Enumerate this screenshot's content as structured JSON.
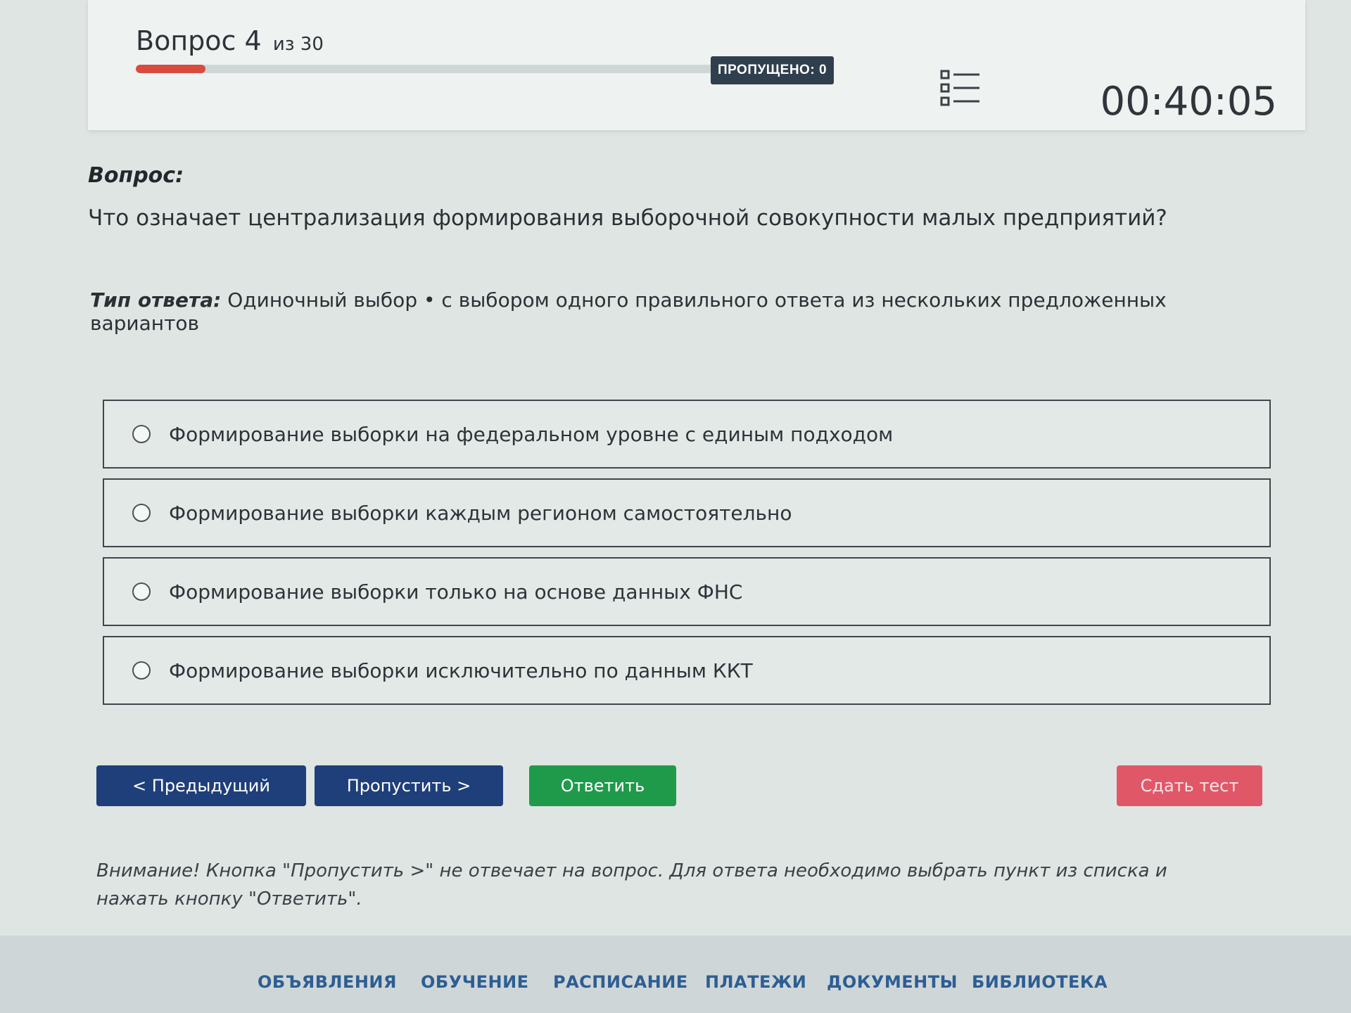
{
  "header": {
    "question_word": "Вопрос",
    "question_number": "4",
    "question_total": "из 30",
    "progress_fraction": 0.1,
    "skipped_badge": "ПРОПУЩЕНО: 0",
    "list_icon": "list-icon",
    "timer": "00:40:05"
  },
  "question": {
    "label": "Вопрос:",
    "text": "Что означает централизация формирования выборочной совокупности малых предприятий?",
    "answer_type_label": "Тип ответа:",
    "answer_type_value": "Одиночный выбор • с выбором одного правильного ответа из нескольких предложенных вариантов"
  },
  "options": [
    {
      "label": "Формирование выборки на федеральном уровне с единым подходом"
    },
    {
      "label": "Формирование выборки каждым регионом самостоятельно"
    },
    {
      "label": "Формирование выборки только на основе данных ФНС"
    },
    {
      "label": "Формирование выборки исключительно по данным ККТ"
    }
  ],
  "buttons": {
    "prev": "< Предыдущий",
    "skip": "Пропустить >",
    "answer": "Ответить",
    "submit": "Сдать тест"
  },
  "warning": "Внимание! Кнопка \"Пропустить >\" не отвечает на вопрос. Для ответа необходимо выбрать пункт из списка и нажать кнопку \"Ответить\".",
  "footer_nav": [
    {
      "label": "ОБЪЯВЛЕНИЯ"
    },
    {
      "label": "ОБУЧЕНИЕ"
    },
    {
      "label": "РАСПИСАНИЕ"
    },
    {
      "label": "ПЛАТЕЖИ"
    },
    {
      "label": "ДОКУМЕНТЫ"
    },
    {
      "label": "БИБЛИОТЕКА"
    }
  ],
  "colors": {
    "progress": "#d84b3e",
    "primary": "#1f3f7a",
    "success": "#1f9a4b",
    "danger": "#e05868",
    "nav_link": "#2d5e92"
  }
}
